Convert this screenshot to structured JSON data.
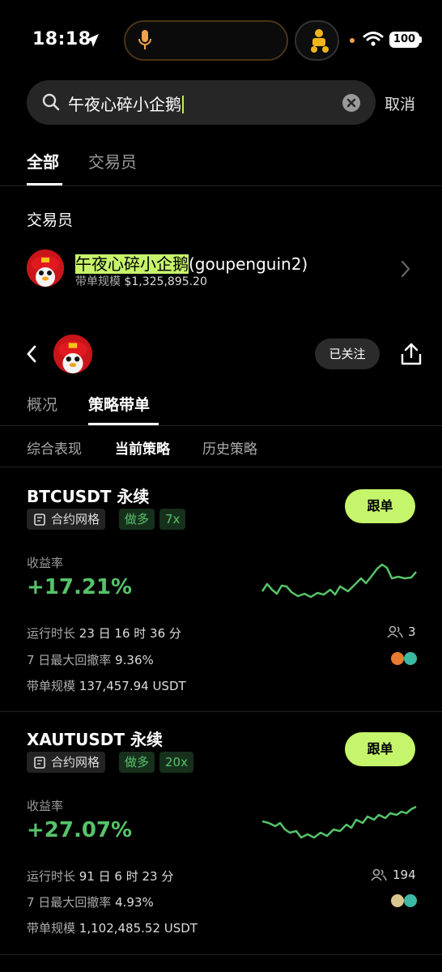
{
  "status_bar": {
    "time": "18:18",
    "battery": "100"
  },
  "search": {
    "query": "午夜心碎小企鹅",
    "cancel_label": "取消"
  },
  "top_tabs": [
    {
      "label": "全部"
    },
    {
      "label": "交易员"
    }
  ],
  "trader_section": {
    "title": "交易员",
    "name_highlight": "午夜心碎小企鹅",
    "name_handle": "(goupenguin2)",
    "scale_label": "带单规模",
    "scale_value": "$1,325,895.20"
  },
  "profile": {
    "follow_status": "已关注",
    "tabs": [
      {
        "label": "概况"
      },
      {
        "label": "策略带单"
      }
    ],
    "sub_tabs": [
      {
        "label": "综合表现"
      },
      {
        "label": "当前策略"
      },
      {
        "label": "历史策略"
      }
    ]
  },
  "strategies": [
    {
      "pair": "BTCUSDT 永续",
      "type_tag": "合约网格",
      "direction_tag": "做多",
      "leverage_tag": "7x",
      "follow_label": "跟单",
      "yield_label": "收益率",
      "yield_value": "+17.21%",
      "runtime_label": "运行时长",
      "runtime_value": "23 日 16 时 36 分",
      "drawdown_label": "7 日最大回撤率",
      "drawdown_value": "9.36%",
      "scale_label": "带单规模",
      "scale_value": "137,457.94 USDT",
      "followers": "3"
    },
    {
      "pair": "XAUTUSDT 永续",
      "type_tag": "合约网格",
      "direction_tag": "做多",
      "leverage_tag": "20x",
      "follow_label": "跟单",
      "yield_label": "收益率",
      "yield_value": "+27.07%",
      "runtime_label": "运行时长",
      "runtime_value": "91 日 6 时 23 分",
      "drawdown_label": "7 日最大回撤率",
      "drawdown_value": "4.93%",
      "scale_label": "带单规模",
      "scale_value": "1,102,485.52 USDT",
      "followers": "194"
    }
  ],
  "colors": {
    "accent_lime": "#c5f56a",
    "gain_green": "#56c36a",
    "background": "#000000"
  },
  "icons": [
    "location-arrow-icon",
    "microphone-icon",
    "delivery-app-icon",
    "wifi-icon",
    "battery-icon",
    "search-icon",
    "clear-icon",
    "chevron-right-icon",
    "back-icon",
    "share-icon",
    "grid-document-icon",
    "followers-icon",
    "bitcoin-icon",
    "tether-icon",
    "gold-icon"
  ]
}
